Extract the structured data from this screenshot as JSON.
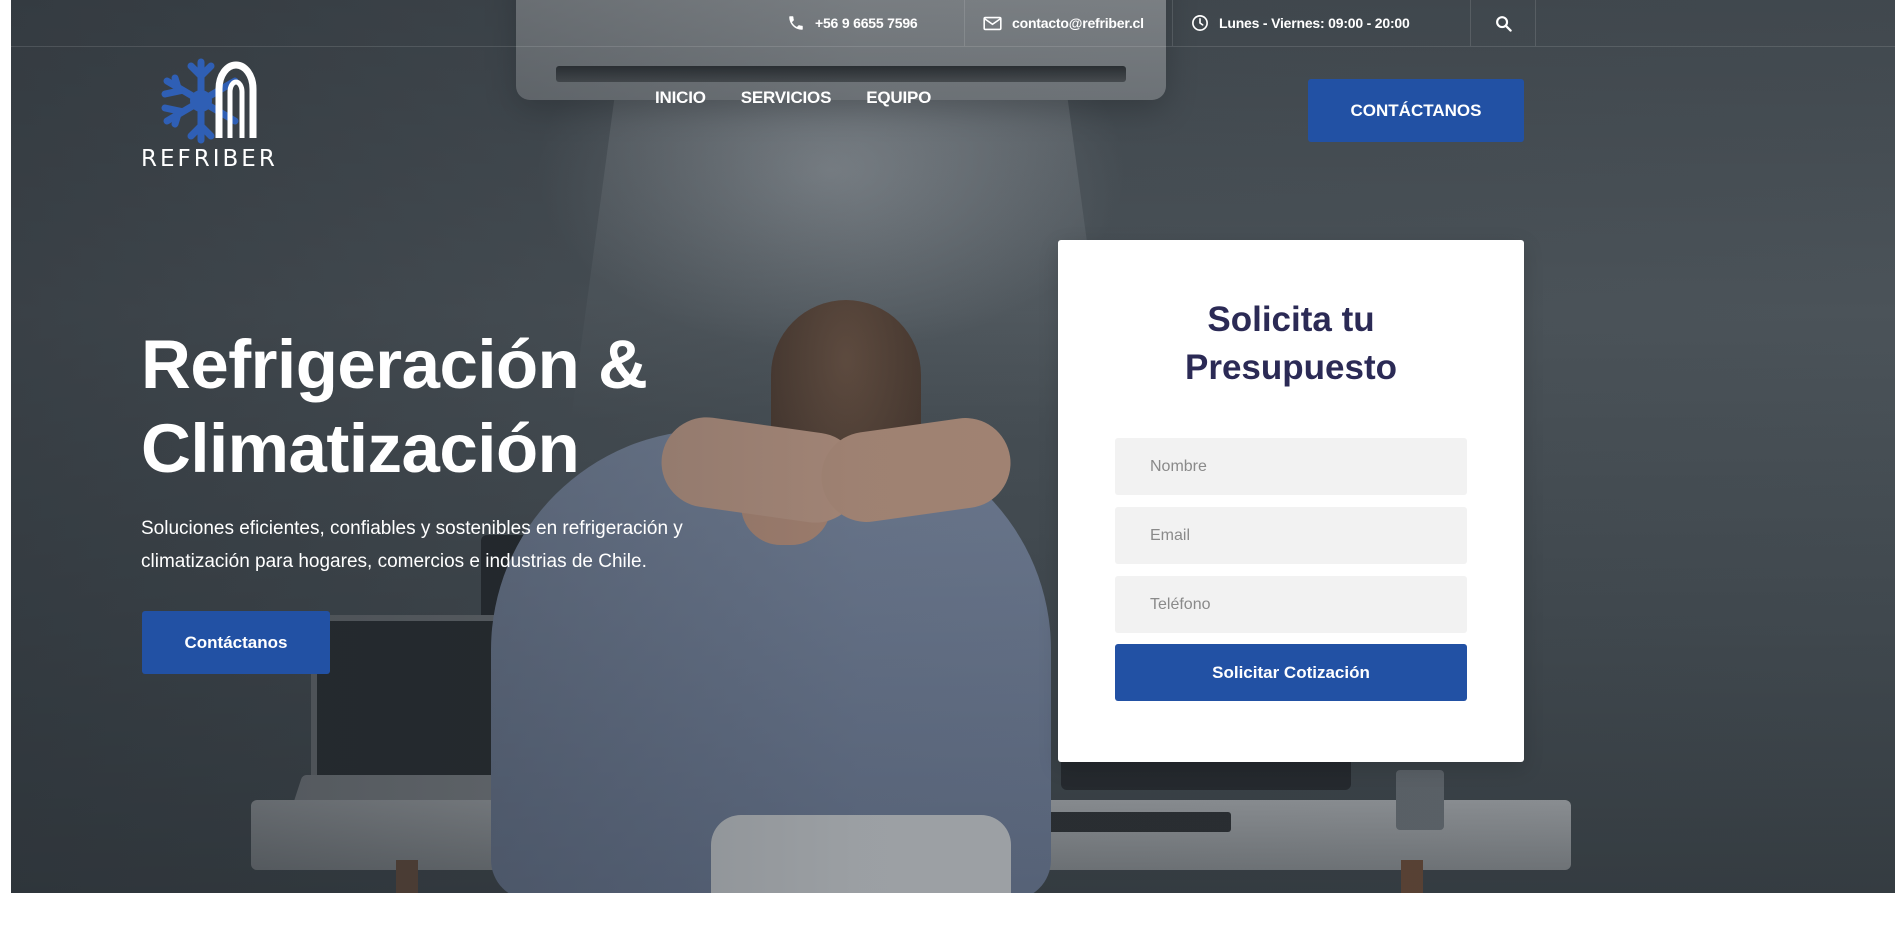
{
  "topbar": {
    "phone": "+56 9 6655 7596",
    "email": "contacto@refriber.cl",
    "hours": "Lunes - Viernes: 09:00 - 20:00",
    "icons": [
      "phone-icon",
      "mail-icon",
      "clock-icon",
      "search-icon"
    ]
  },
  "logo": {
    "text": "REFRIBER"
  },
  "nav": {
    "items": [
      {
        "label": "INICIO"
      },
      {
        "label": "SERVICIOS"
      },
      {
        "label": "EQUIPO"
      }
    ]
  },
  "header": {
    "cta_label": "CONTÁCTANOS"
  },
  "hero": {
    "title_line1": "Refrigeración &",
    "title_line2": "Climatización",
    "subtitle_line1": "Soluciones eficientes, confiables y sostenibles en refrigeración y",
    "subtitle_line2": "climatización para hogares, comercios e industrias de Chile.",
    "cta_label": "Contáctanos"
  },
  "quote_form": {
    "title_line1": "Solicita tu",
    "title_line2": "Presupuesto",
    "name_placeholder": "Nombre",
    "email_placeholder": "Email",
    "phone_placeholder": "Teléfono",
    "submit_label": "Solicitar Cotización"
  },
  "colors": {
    "accent": "#2251a4",
    "title_dark": "#2b2a55",
    "logo_blue": "#2f5fb5",
    "input_bg": "#f2f2f2"
  }
}
